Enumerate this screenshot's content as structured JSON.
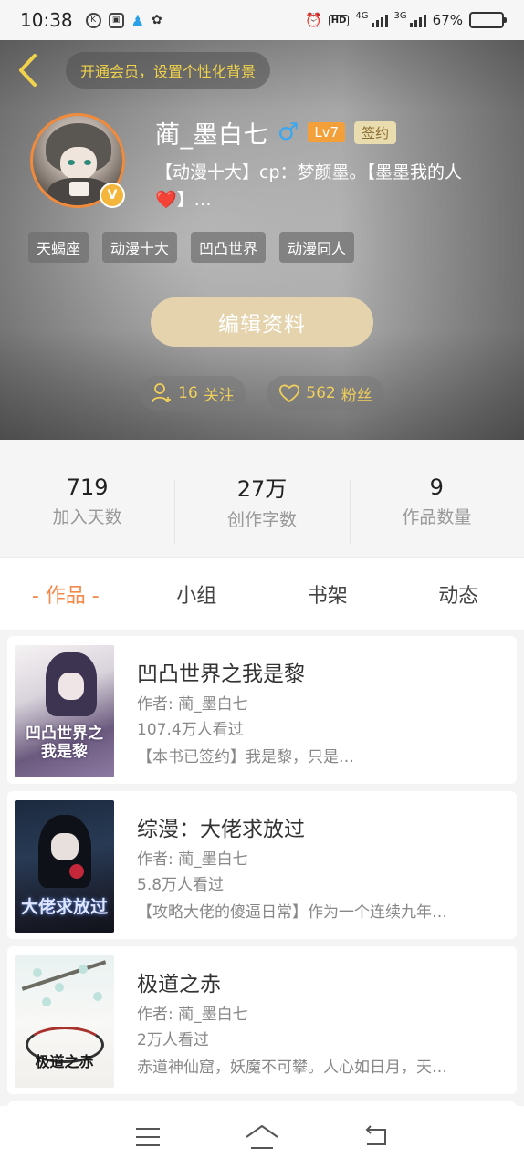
{
  "status_bar": {
    "time": "10:38",
    "network_4g": "4G",
    "network_3g": "3G",
    "hd": "HD",
    "battery_text": "67%",
    "battery_level": 0.67,
    "battery_color": "#8bd35c"
  },
  "header": {
    "back_icon": "chevron-left-icon",
    "vip_banner": "开通会员，设置个性化背景",
    "accent_color": "#f1d24b"
  },
  "profile": {
    "name": "蔺_墨白七",
    "gender_symbol": "♂",
    "level": "Lv7",
    "signed_badge": "签约",
    "verified_badge": "V",
    "bio_line1": "【动漫十大】cp：梦颜墨。【墨墨我的人",
    "bio_heart": "❤️",
    "bio_line2_rest": "】…",
    "tags": [
      "天蝎座",
      "动漫十大",
      "凹凸世界",
      "动漫同人"
    ],
    "edit_button": "编辑资料",
    "follow_count": "16",
    "follow_label": "关注",
    "fans_count": "562",
    "fans_label": "粉丝"
  },
  "stats": [
    {
      "value": "719",
      "label": "加入天数"
    },
    {
      "value": "27万",
      "label": "创作字数"
    },
    {
      "value": "9",
      "label": "作品数量"
    }
  ],
  "tabs": [
    {
      "label": "- 作品 -",
      "active": true
    },
    {
      "label": "小组",
      "active": false
    },
    {
      "label": "书架",
      "active": false
    },
    {
      "label": "动态",
      "active": false
    }
  ],
  "active_tab_color": "#f2894a",
  "books": [
    {
      "title": "凹凸世界之我是黎",
      "author": "作者: 蔺_墨白七",
      "views": "107.4万人看过",
      "description": "【本书已签约】我是黎，只是…",
      "cover_text": "凹凸世界之我是黎"
    },
    {
      "title": "综漫：大佬求放过",
      "author": "作者: 蔺_墨白七",
      "views": "5.8万人看过",
      "description": "【攻略大佬的傻逼日常】作为一个连续九年…",
      "cover_text": "大佬求放过"
    },
    {
      "title": "极道之赤",
      "author": "作者: 蔺_墨白七",
      "views": "2万人看过",
      "description": "赤道神仙窟，妖魔不可攀。人心如日月，天…",
      "cover_text": "极道之赤"
    }
  ],
  "bottom_nav": {
    "menu_icon": "menu-icon",
    "home_icon": "home-icon",
    "back_icon": "back-arrow-icon"
  }
}
